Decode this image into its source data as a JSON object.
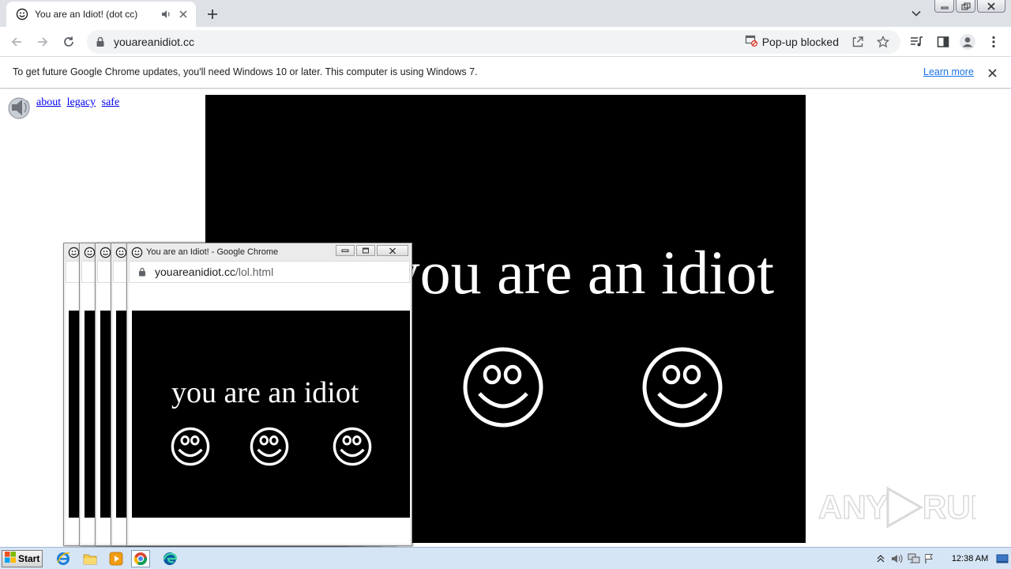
{
  "browser": {
    "tab_title": "You are an Idiot! (dot cc)",
    "url": "youareanidiot.cc",
    "popup_blocked": "Pop-up blocked"
  },
  "infobar": {
    "message": "To get future Google Chrome updates, you'll need Windows 10 or later. This computer is using Windows 7.",
    "learn_more": "Learn more"
  },
  "page": {
    "links": [
      "about",
      "legacy",
      "safe"
    ],
    "big_text": "you are an idiot"
  },
  "popup": {
    "title": "You are an Idiot! - Google Chrome",
    "url_domain": "youareanidiot.cc",
    "url_path": "/lol.html",
    "text": "you are an idiot"
  },
  "taskbar": {
    "start": "Start",
    "clock": "12:38 AM"
  },
  "watermark": "ANY RUN",
  "colors": {
    "link": "#0000ee",
    "accent": "#1a73e8",
    "page_bg": "#000000"
  }
}
